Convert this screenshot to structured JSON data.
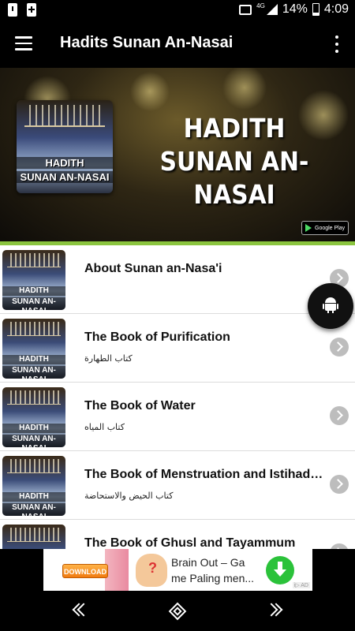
{
  "status_bar": {
    "network": "4G",
    "battery": "14%",
    "time": "4:09"
  },
  "app_bar": {
    "title": "Hadits Sunan An-Nasai"
  },
  "banner": {
    "heading_line1": "HADITH",
    "heading_line2": "SUNAN AN-NASAI",
    "book_line1": "HADITH",
    "book_line2": "SUNAN AN-NASAI",
    "store_badge_small": "GET IT ON",
    "store_badge": "Google Play"
  },
  "list": {
    "thumb_line1": "HADITH",
    "thumb_line2": "SUNAN AN-NASAI",
    "items": [
      {
        "title": "About Sunan an-Nasa'i",
        "subtitle": ""
      },
      {
        "title": "The Book of Purification",
        "subtitle": "كتاب الطهارة"
      },
      {
        "title": "The Book of Water",
        "subtitle": "كتاب المياه"
      },
      {
        "title": "The Book of Menstruation and Istihada...",
        "subtitle": "كتاب الحيض والاستحاضة"
      },
      {
        "title": "The Book of Ghusl and Tayammum",
        "subtitle": ""
      }
    ]
  },
  "ad": {
    "download_label": "DOWNLOAD",
    "text_line1": "Brain Out – Ga",
    "text_line2": "me Paling men...",
    "badge": "i▷ AD"
  },
  "colors": {
    "accent_line": "#8bc53f",
    "install_button": "#2bc23a"
  },
  "icons": [
    "menu-icon",
    "overflow-icon",
    "android-icon",
    "chevron-right-icon",
    "back-icon",
    "home-icon",
    "recent-icon"
  ]
}
